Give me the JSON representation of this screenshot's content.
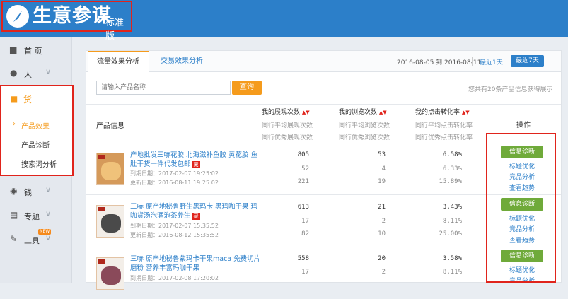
{
  "brand": {
    "title": "生意参谋",
    "edition": "标准版"
  },
  "sidebar": {
    "items": [
      {
        "label": "首  页",
        "icon": "home-icon"
      },
      {
        "label": "人",
        "icon": "user-icon"
      },
      {
        "label": "货",
        "icon": "bag-icon"
      },
      {
        "label": "钱",
        "icon": "money-icon"
      },
      {
        "label": "专题",
        "icon": "document-icon"
      },
      {
        "label": "工具",
        "icon": "wrench-icon"
      }
    ],
    "sub_items": [
      {
        "label": "产品效果"
      },
      {
        "label": "产品诊断"
      },
      {
        "label": "搜索词分析"
      }
    ],
    "new_badge": "NEW"
  },
  "tabs": [
    {
      "label": "流量效果分析"
    },
    {
      "label": "交易效果分析"
    }
  ],
  "date_range": "2016-08-05 到 2016-08-11",
  "range_buttons": {
    "last1": "最近1天",
    "last7": "最近7天"
  },
  "search": {
    "placeholder": "请输入产品名称",
    "button": "查询"
  },
  "total_text": "您共有20条产品信息获得展示",
  "table": {
    "col_product": "产品信息",
    "col_exposure": {
      "title": "我的展现次数",
      "avg": "同行平均展现次数",
      "best": "同行优秀展现次数"
    },
    "col_views": {
      "title": "我的浏览次数",
      "avg": "同行平均浏览次数",
      "best": "同行优秀浏览次数"
    },
    "col_ctr": {
      "title": "我的点击转化率",
      "avg": "同行平均点击转化率",
      "best": "同行优秀点击转化率"
    },
    "col_ops": "操作",
    "rows": [
      {
        "title": "产地批发三哧花胶 北海滋补鱼胶 黄花胶 鱼肚干货一件代发包邮",
        "tag": "藏",
        "expire": "到期日期：2017-02-07 19:25:02",
        "update": "更新日期：2016-08-11 19:25:02",
        "exposure": [
          "805",
          "52",
          "221"
        ],
        "views": [
          "53",
          "4",
          "19"
        ],
        "ctr": [
          "6.58%",
          "6.33%",
          "15.89%"
        ]
      },
      {
        "title": "三哧 原产地秘鲁野生黑玛卡 黑玛咖干果 玛咖货汤泡酒泡茶养生",
        "tag": "藏",
        "expire": "到期日期：2017-02-07 15:35:52",
        "update": "更新日期：2016-08-12 15:35:52",
        "exposure": [
          "613",
          "17",
          "82"
        ],
        "views": [
          "21",
          "2",
          "10"
        ],
        "ctr": [
          "3.43%",
          "8.11%",
          "25.00%"
        ]
      },
      {
        "title": "三哧 原产地秘鲁紫玛卡干果maca 免费切片磨粉 营养丰富玛咖干果",
        "tag": "",
        "expire": "到期日期：2017-02-08 17:20:02",
        "update": "",
        "exposure": [
          "558",
          "17",
          ""
        ],
        "views": [
          "20",
          "2",
          ""
        ],
        "ctr": [
          "3.58%",
          "8.11%",
          ""
        ]
      }
    ],
    "ops": {
      "diagnose": "信息诊断",
      "title_opt": "标题优化",
      "category": "竞品分析",
      "trend": "查看趋势"
    }
  },
  "colors": {
    "header": "#2c7fc9",
    "accent": "#f59b1c",
    "highlight_border": "#e0241c",
    "op_button": "#6faa3a"
  }
}
